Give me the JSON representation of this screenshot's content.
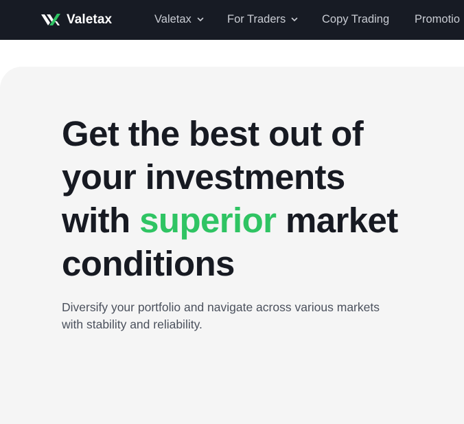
{
  "nav": {
    "brand": "Valetax",
    "items": [
      {
        "label": "Valetax",
        "has_dropdown": true
      },
      {
        "label": "For Traders",
        "has_dropdown": true
      },
      {
        "label": "Copy Trading",
        "has_dropdown": false
      },
      {
        "label": "Promotio",
        "has_dropdown": false
      }
    ]
  },
  "hero": {
    "headline_line1": "Get the best out of",
    "headline_line2": "your investments",
    "headline_line3_pre": "with ",
    "headline_accent": "superior",
    "headline_line3_post": " market",
    "headline_line4": "conditions",
    "subtext_line1": "Diversify your portfolio and navigate across various markets",
    "subtext_line2": "with stability and reliability."
  },
  "colors": {
    "nav_background": "#171b24",
    "hero_background": "#f5f5f5",
    "accent": "#2fc463",
    "headline": "#171a22",
    "body_text": "#4b515d"
  }
}
